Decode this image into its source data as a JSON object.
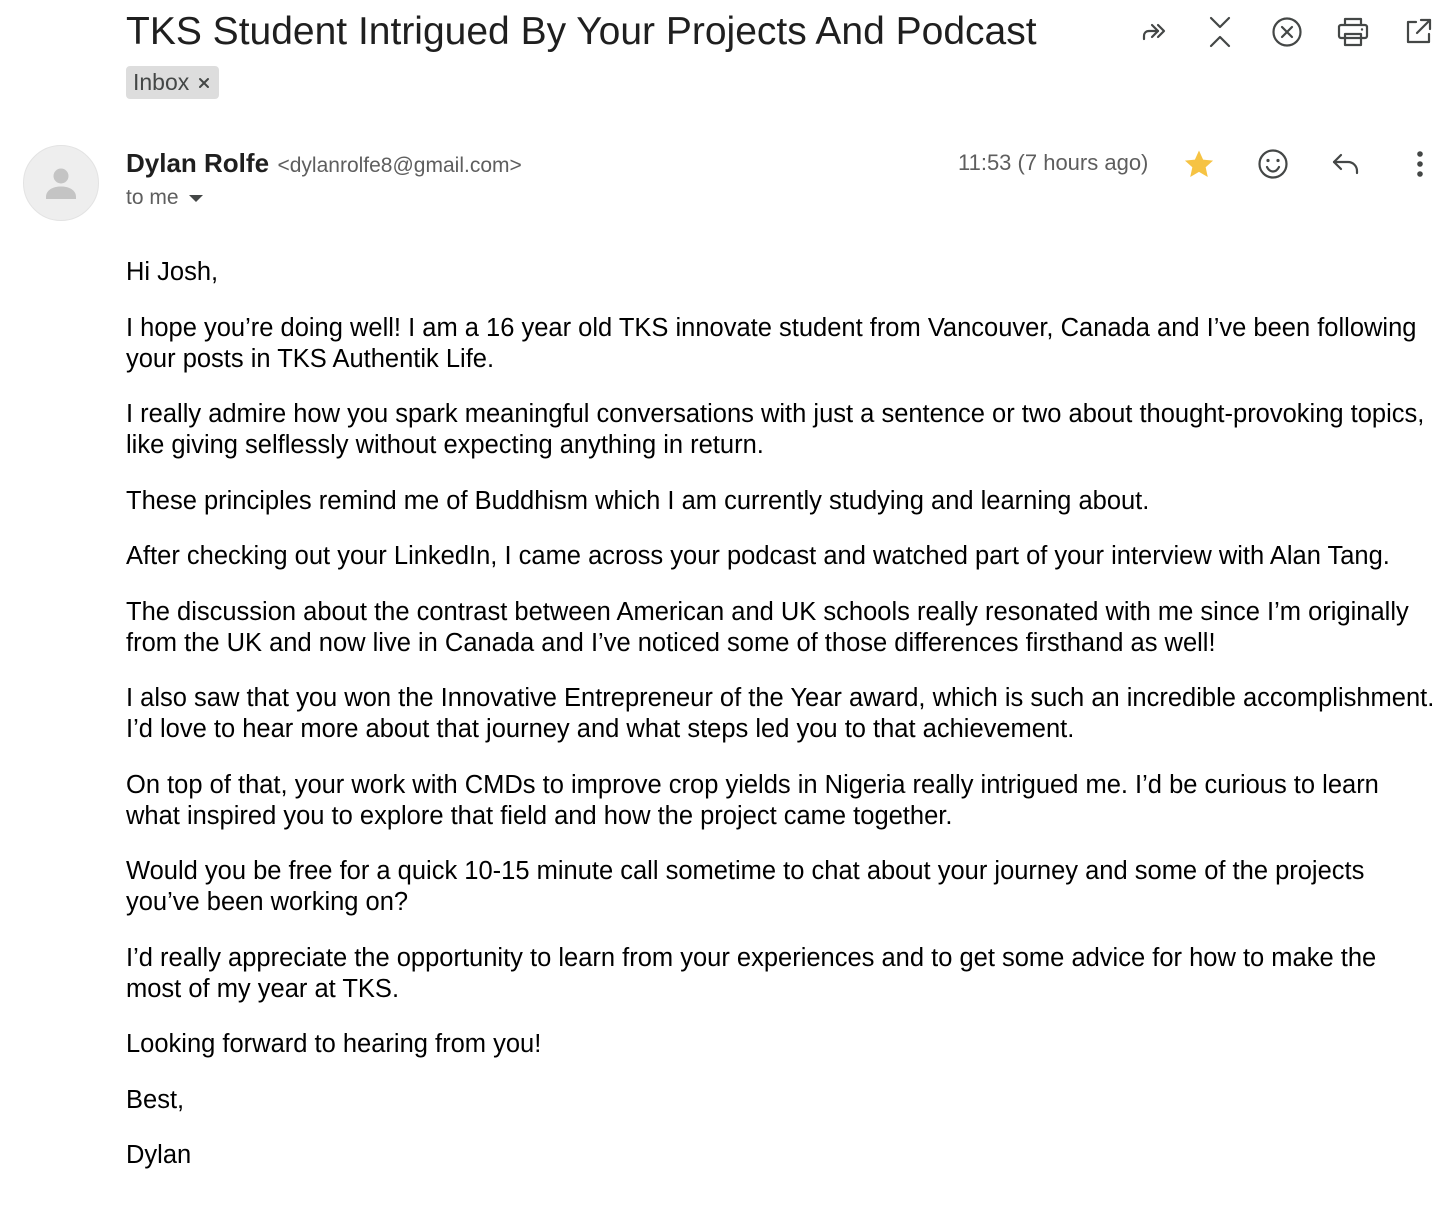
{
  "email": {
    "subject": "TKS Student Intrigued By Your Projects And Podcast",
    "label": "Inbox",
    "sender_name": "Dylan Rolfe",
    "sender_email": "<dylanrolfe8@gmail.com>",
    "recipient": "to me",
    "timestamp": "11:53 (7 hours ago)",
    "starred": true,
    "star_color": "#f6c343",
    "body": [
      "Hi Josh,",
      "I hope you’re doing well! I am a 16 year old TKS innovate student from Vancouver, Canada and I’ve been following your posts in TKS Authentik Life.",
      "I really admire how you spark meaningful conversations with just a sentence or two about thought-provoking topics, like giving selflessly without expecting anything in return.",
      "These principles remind me of Buddhism which I am currently studying and learning about.",
      "After checking out your LinkedIn, I came across your podcast and watched part of your interview with Alan Tang.",
      "The discussion about the contrast between American and UK schools really resonated with me since I’m originally from the UK and now live in Canada and I’ve noticed some of those differences firsthand as well!",
      "I also saw that you won the Innovative Entrepreneur of the Year award, which is such an incredible accomplishment. I’d love to hear more about that journey and what steps led you to that achievement.",
      "On top of that, your work with CMDs to improve crop yields in Nigeria really intrigued me. I’d be curious to learn what inspired you to explore that field and how the project came together.",
      "Would you be free for a quick 10-15 minute call sometime to chat about your journey and some of the projects you’ve been working on?",
      "I’d really appreciate the opportunity to learn from your experiences and to get some advice for how to make the most of my year at TKS.",
      "Looking forward to hearing from you!",
      "Best,",
      "Dylan"
    ]
  },
  "icons": {
    "top": [
      "forward-all-icon",
      "collapse-all-icon",
      "close-circle-icon",
      "print-icon",
      "open-in-new-window-icon"
    ],
    "message": [
      "star-icon",
      "emoji-reaction-icon",
      "reply-icon",
      "more-vert-icon"
    ]
  }
}
